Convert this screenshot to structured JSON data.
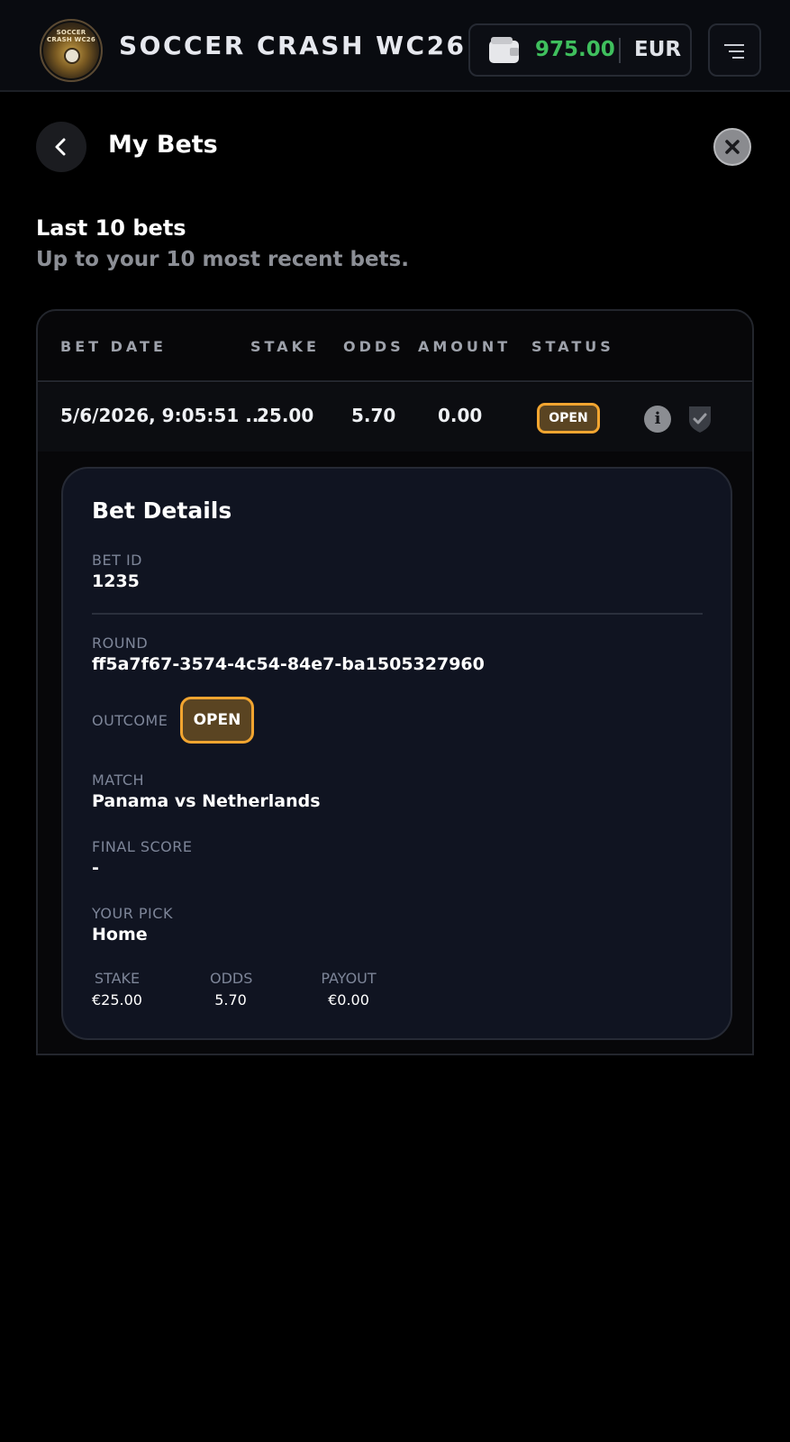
{
  "header": {
    "logo_text": "SOCCER CRASH WC26",
    "app_title": "SOCCER CRASH WC26",
    "balance": "975.00",
    "currency": "EUR",
    "balance_color": "#3fbf5d"
  },
  "page": {
    "title": "My Bets",
    "section_title": "Last 10 bets",
    "section_subtitle": "Up to your 10 most recent bets."
  },
  "table": {
    "headers": {
      "bet_date": "BET DATE",
      "stake": "STAKE",
      "odds": "ODDS",
      "amount": "AMOUNT",
      "status": "STATUS"
    },
    "rows": [
      {
        "bet_date": "5/6/2026, 9:05:51 ...",
        "stake": "25.00",
        "odds": "5.70",
        "amount": "0.00",
        "status": "OPEN"
      }
    ]
  },
  "details": {
    "title": "Bet Details",
    "bet_id_label": "BET ID",
    "bet_id": "1235",
    "round_label": "ROUND",
    "round": "ff5a7f67-3574-4c54-84e7-ba1505327960",
    "outcome_label": "OUTCOME",
    "outcome": "OPEN",
    "match_label": "MATCH",
    "match": "Panama vs Netherlands",
    "final_score_label": "FINAL SCORE",
    "final_score": "-",
    "pick_label": "YOUR PICK",
    "pick": "Home",
    "stake_label": "STAKE",
    "stake": "€25.00",
    "odds_label": "ODDS",
    "odds": "5.70",
    "payout_label": "PAYOUT",
    "payout": "€0.00"
  },
  "colors": {
    "accent_open": "#f2a530",
    "panel_bg": "#101421"
  },
  "icons": [
    "wallet-icon",
    "menu-icon",
    "back-arrow-icon",
    "close-icon",
    "info-icon",
    "shield-check-icon"
  ]
}
